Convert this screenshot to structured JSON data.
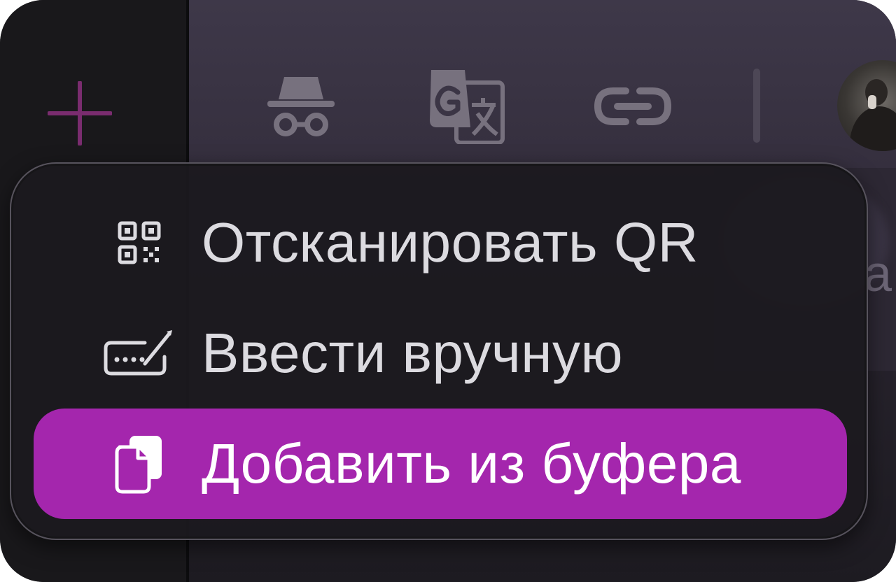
{
  "colors": {
    "accent": "#a426ad",
    "menu_background": "#1c1a1f",
    "toolbar_background": "#3b3545",
    "icon_muted": "#77717e",
    "add_icon": "#7a2c6f"
  },
  "sidebar": {
    "add_button_icon": "plus-icon"
  },
  "toolbar": {
    "icons": [
      "incognito-icon",
      "translate-icon",
      "link-icon"
    ],
    "avatar": "user-avatar"
  },
  "background": {
    "partial_text": "a"
  },
  "menu": {
    "items": [
      {
        "icon": "qr-code-icon",
        "label": "Отсканировать QR",
        "selected": false
      },
      {
        "icon": "keyboard-pen-icon",
        "label": "Ввести вручную",
        "selected": false
      },
      {
        "icon": "clipboard-copy-icon",
        "label": "Добавить из буфера",
        "selected": true
      }
    ]
  }
}
